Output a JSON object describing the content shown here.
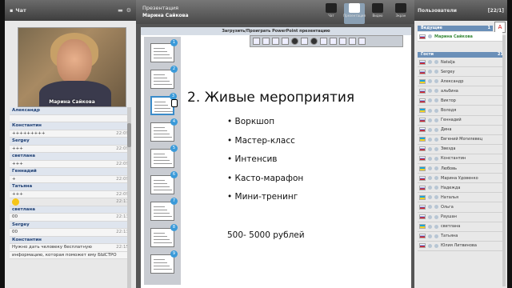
{
  "chat_panel": {
    "title": "Чат",
    "video_name": "Марина Сайкова",
    "messages": [
      {
        "kind": "name",
        "text": "Александр",
        "time": ""
      },
      {
        "kind": "text",
        "text": "",
        "time": ""
      },
      {
        "kind": "name",
        "text": "Константин",
        "time": ""
      },
      {
        "kind": "text",
        "text": "+++++++++",
        "time": "22:09"
      },
      {
        "kind": "name",
        "text": "Sergey",
        "time": ""
      },
      {
        "kind": "text",
        "text": "+++",
        "time": "22:09"
      },
      {
        "kind": "name",
        "text": "светлана",
        "time": ""
      },
      {
        "kind": "text",
        "text": "+++",
        "time": "22:09"
      },
      {
        "kind": "name",
        "text": "Геннадий",
        "time": ""
      },
      {
        "kind": "text",
        "text": "+",
        "time": "22:09"
      },
      {
        "kind": "name",
        "text": "Татьяна",
        "time": ""
      },
      {
        "kind": "text",
        "text": "+++",
        "time": "22:09"
      },
      {
        "kind": "smile",
        "text": "",
        "time": "22:11"
      },
      {
        "kind": "name",
        "text": "светлана",
        "time": ""
      },
      {
        "kind": "text",
        "text": "00",
        "time": "22:13"
      },
      {
        "kind": "name",
        "text": "Sergey",
        "time": ""
      },
      {
        "kind": "text",
        "text": "00",
        "time": "22:13"
      },
      {
        "kind": "name",
        "text": "Константин",
        "time": ""
      },
      {
        "kind": "text",
        "text": "Нужно дать человеку бесплатную",
        "time": "22:15"
      },
      {
        "kind": "text",
        "text": "информацию, которая поможет ему БЫСТРО",
        "time": ""
      }
    ]
  },
  "presentation": {
    "header_title": "Презентация",
    "presenter": "Марина Сайкова",
    "tools": [
      {
        "label": "Чат",
        "active": false
      },
      {
        "label": "Презентация",
        "active": true
      },
      {
        "label": "Видео",
        "active": false
      },
      {
        "label": "Экран",
        "active": false
      }
    ],
    "upload_label": "Загрузить/Проиграть PowerPoint презентацию",
    "thumbs": [
      "1",
      "2",
      "3",
      "4",
      "5",
      "6",
      "7",
      "8",
      "9"
    ],
    "slide_title": "2. Живые мероприятия",
    "bullets": [
      "Воркшоп",
      "Мастер-класс",
      "Интенсив",
      "Касто-марафон",
      "Мини-тренинг"
    ],
    "price": "500- 5000 рублей"
  },
  "users_panel": {
    "title": "Пользователи",
    "count": "[22/1]",
    "leaders_label": "Ведущие",
    "guests_label": "Гости",
    "leaders_count": "1",
    "guests_count": "21",
    "leader": "Марина Сайкова",
    "guests": [
      "Natalja",
      "Sergey",
      "Александр",
      "альбина",
      "Виктор",
      "Володя",
      "Геннадий",
      "Дина",
      "Евгений Могилевец",
      "Звезда",
      "Константин",
      "Любовь",
      "Марина Удовенко",
      "Надежда",
      "Наталья",
      "Ольга",
      "Раушан",
      "светлана",
      "Татьяна",
      "Юлия Литвинова"
    ]
  }
}
